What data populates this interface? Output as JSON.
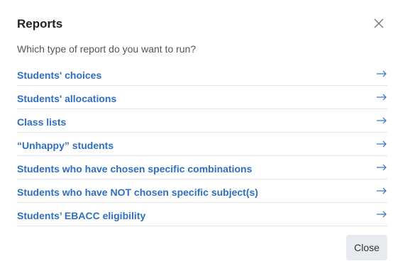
{
  "dialog": {
    "title": "Reports",
    "subtitle": "Which type of report do you want to run?",
    "close_button_label": "Close"
  },
  "reports": [
    {
      "label": "Students' choices"
    },
    {
      "label": "Students' allocations"
    },
    {
      "label": "Class lists"
    },
    {
      "label": "“Unhappy” students"
    },
    {
      "label": "Students who have chosen specific combinations"
    },
    {
      "label": "Students who have NOT chosen specific subject(s)"
    },
    {
      "label": "Students’ EBACC eligibility"
    }
  ],
  "icons": {
    "dismiss": "close-icon",
    "row_arrow": "arrow-right-icon"
  },
  "colors": {
    "link": "#2f6fbf",
    "title": "#222222",
    "subtitle": "#555555",
    "divider": "#e6e6e6",
    "button_bg": "#e7eaee"
  }
}
